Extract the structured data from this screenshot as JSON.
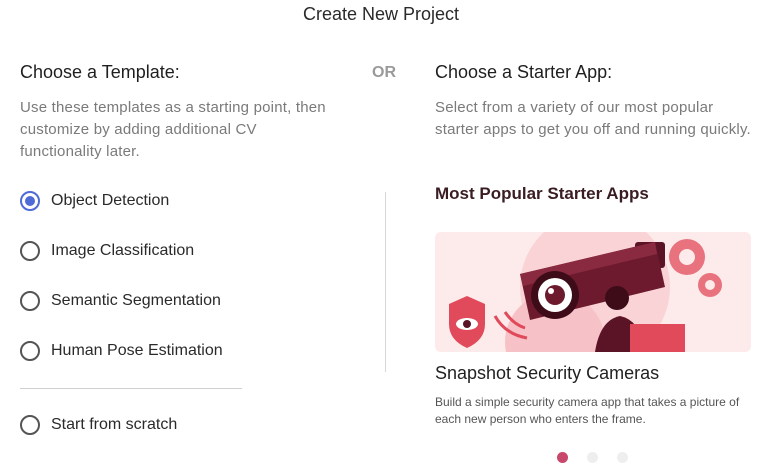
{
  "dialog": {
    "title": "Create New Project"
  },
  "template_section": {
    "heading": "Choose a Template:",
    "description": "Use these templates as a starting point, then customize by adding additional CV functionality later.",
    "options": [
      {
        "label": "Object Detection",
        "selected": true
      },
      {
        "label": "Image Classification",
        "selected": false
      },
      {
        "label": "Semantic Segmentation",
        "selected": false
      },
      {
        "label": "Human Pose Estimation",
        "selected": false
      }
    ],
    "scratch_option": {
      "label": "Start from scratch",
      "selected": false
    }
  },
  "or_label": "OR",
  "starter_section": {
    "heading": "Choose a Starter App:",
    "description": "Select from a variety of our most popular starter apps to get you off and running quickly.",
    "popular_heading": "Most Popular Starter Apps",
    "card": {
      "image_icon": "security-camera-illustration",
      "title": "Snapshot Security Cameras",
      "description": "Build a simple security camera app that takes a picture of each new person who enters the frame."
    },
    "carousel": {
      "total": 3,
      "active_index": 0
    }
  },
  "colors": {
    "radio_accent": "#4f6bd8",
    "carousel_active": "#c7486b",
    "illustration_dark": "#5a1426",
    "illustration_red": "#e04a5a"
  }
}
